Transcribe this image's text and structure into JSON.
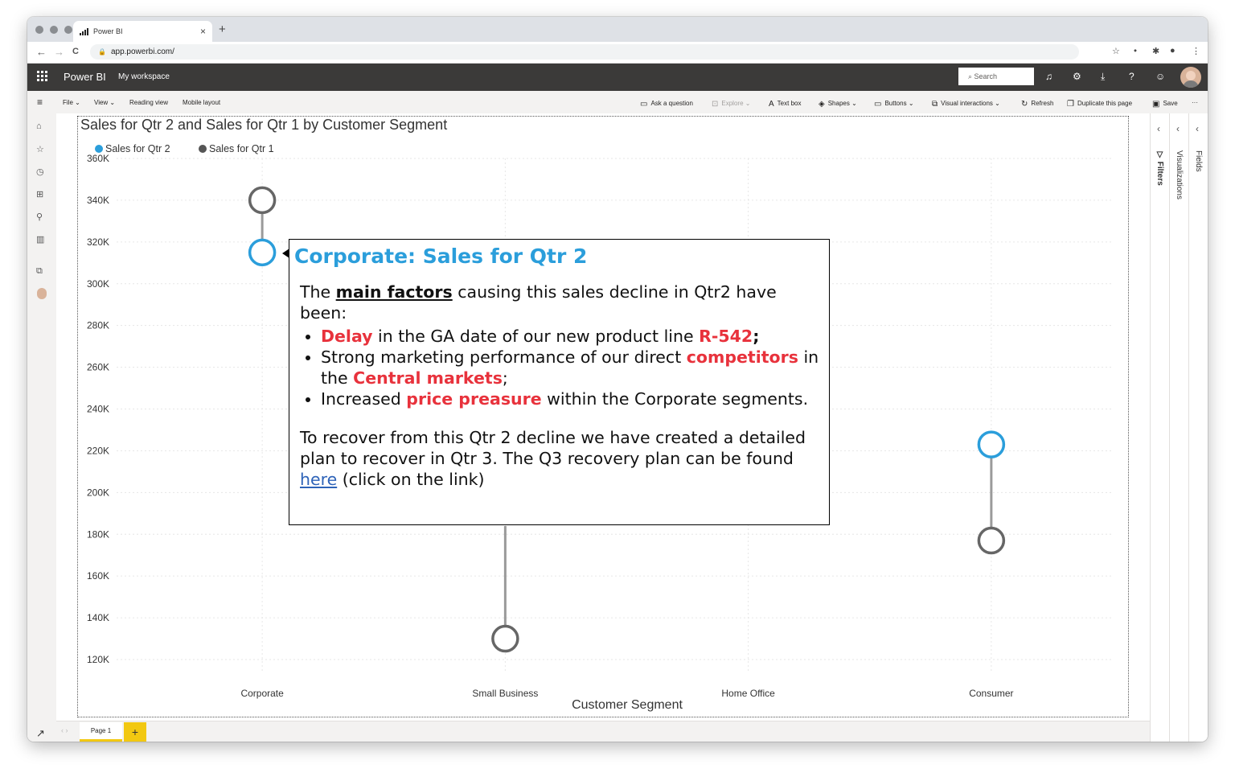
{
  "browser": {
    "tab_title": "Power BI",
    "tab_close": "×",
    "new_tab": "+",
    "url": "app.powerbi.com/",
    "nav_back": "←",
    "nav_forward": "→",
    "nav_reload": "C",
    "menu_glyph": "⋮"
  },
  "header": {
    "brand": "Power BI",
    "workspace": "My workspace",
    "search_placeholder": "Search",
    "icons": [
      "bell-icon",
      "gear-icon",
      "download-icon",
      "help-icon",
      "smiley-icon",
      "avatar"
    ]
  },
  "ribbon": {
    "file": "File",
    "view": "View",
    "reading_view": "Reading view",
    "mobile_layout": "Mobile layout",
    "ask_question": "Ask a question",
    "explore": "Explore",
    "text_box": "Text box",
    "shapes": "Shapes",
    "buttons": "Buttons",
    "visual_interactions": "Visual interactions",
    "refresh": "Refresh",
    "duplicate_page": "Duplicate this page",
    "save": "Save",
    "more": "···"
  },
  "panes": {
    "filters": "Filters",
    "visualizations": "Visualizations",
    "fields": "Fields"
  },
  "pages": {
    "page1": "Page 1",
    "add": "+"
  },
  "colors": {
    "qtr2": "#2b9edb",
    "qtr1": "#666666",
    "accent": "#f2c811",
    "highlight": "#e8323c"
  },
  "chart_data": {
    "type": "dumbbell",
    "title": "Sales for Qtr 2 and Sales for Qtr 1 by Customer Segment",
    "xlabel": "Customer Segment",
    "ylabel": "",
    "categories": [
      "Corporate",
      "Small Business",
      "Home Office",
      "Consumer"
    ],
    "series": [
      {
        "name": "Sales for Qtr 2",
        "color": "#2b9edb",
        "values": [
          315000,
          null,
          null,
          223000
        ]
      },
      {
        "name": "Sales for Qtr 1",
        "color": "#666666",
        "values": [
          340000,
          130000,
          null,
          177000
        ]
      }
    ],
    "yticks": [
      "120K",
      "140K",
      "160K",
      "180K",
      "200K",
      "220K",
      "240K",
      "260K",
      "280K",
      "300K",
      "320K",
      "340K",
      "360K"
    ],
    "ylim": [
      120000,
      360000
    ],
    "legend_position": "top-left",
    "grid": true
  },
  "callout": {
    "title": "Corporate: Sales for Qtr 2",
    "intro_1": "The ",
    "intro_bold": "main factors",
    "intro_2": " causing this sales decline in Qtr2 have been:",
    "b1_red1": "Delay",
    "b1_text": " in the GA date of our new product line ",
    "b1_red2": "R-542",
    "b1_end": ";",
    "b2_text1": "Strong marketing performance of our direct ",
    "b2_red1": "competitors",
    "b2_text2": " in the ",
    "b2_red2": "Central markets",
    "b2_end": ";",
    "b3_text1": "Increased ",
    "b3_red": "price preasure",
    "b3_text2": " within the Corporate segments.",
    "outro": "To recover from this Qtr 2 decline we have created a detailed plan to recover in Qtr 3. The Q3 recovery plan can be found ",
    "link": "here",
    "outro_end": " (click on the link)"
  }
}
